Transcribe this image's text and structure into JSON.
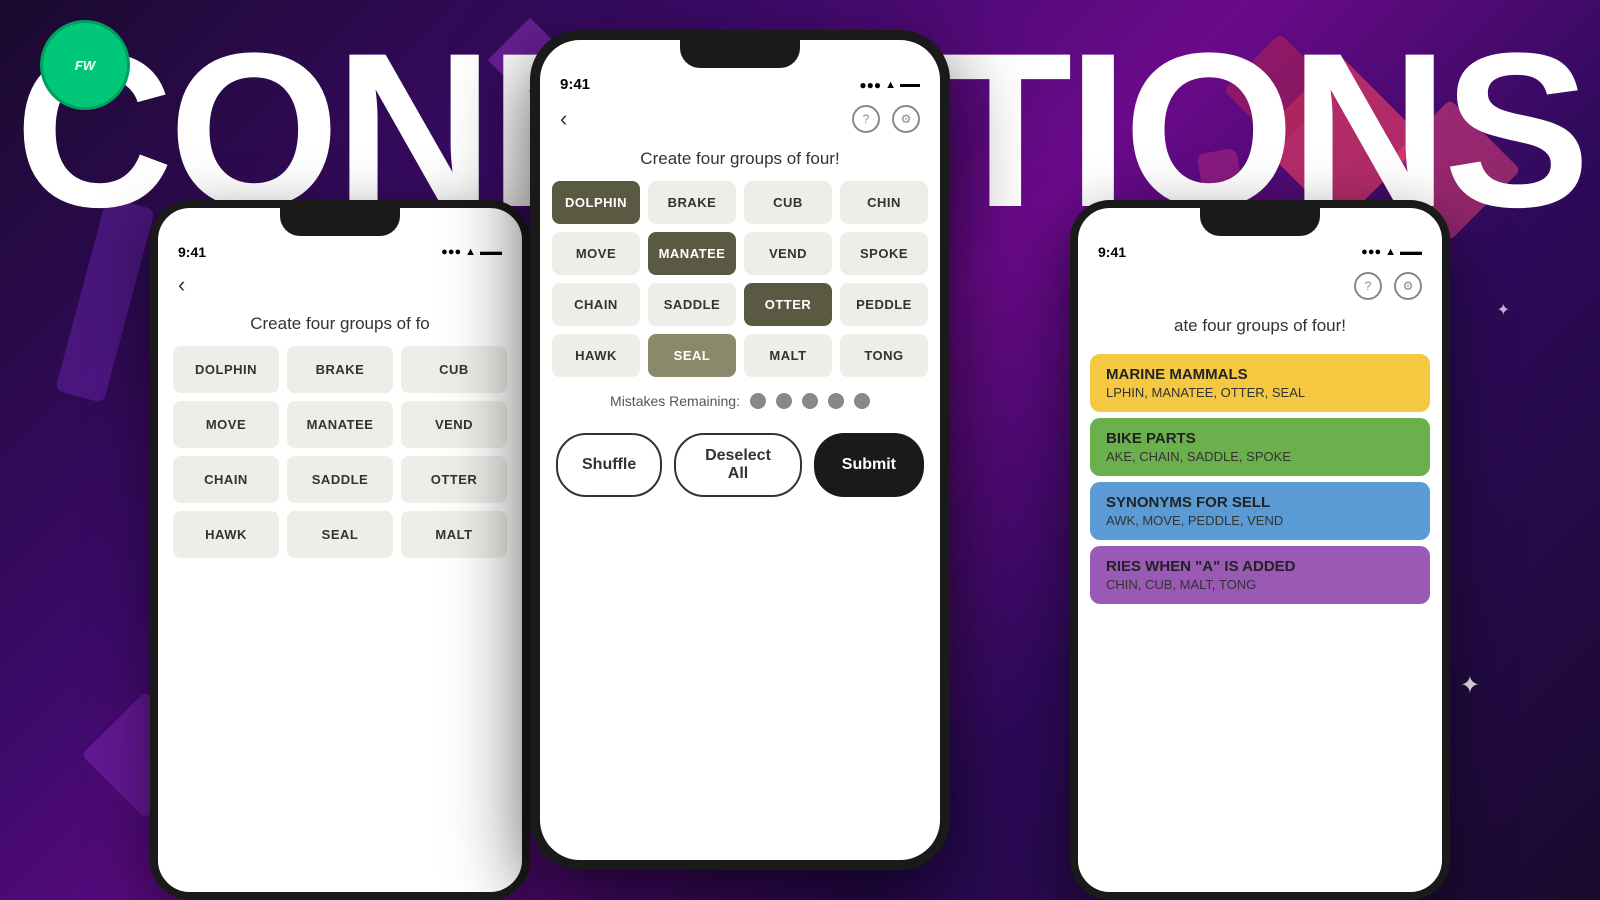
{
  "app": {
    "title": "Connections",
    "logo": "FW"
  },
  "background": {
    "title_text": "Connections"
  },
  "center_phone": {
    "status_time": "9:41",
    "header_back": "‹",
    "header_help": "?",
    "header_settings": "⚙",
    "game_title": "Create four groups of four!",
    "grid": [
      {
        "word": "DOLPHIN",
        "state": "selected-dark"
      },
      {
        "word": "BRAKE",
        "state": "normal"
      },
      {
        "word": "CUB",
        "state": "normal"
      },
      {
        "word": "CHIN",
        "state": "normal"
      },
      {
        "word": "MOVE",
        "state": "normal"
      },
      {
        "word": "MANATEE",
        "state": "selected-dark"
      },
      {
        "word": "VEND",
        "state": "normal"
      },
      {
        "word": "SPOKE",
        "state": "normal"
      },
      {
        "word": "CHAIN",
        "state": "normal"
      },
      {
        "word": "SADDLE",
        "state": "normal"
      },
      {
        "word": "OTTER",
        "state": "selected-dark"
      },
      {
        "word": "PEDDLE",
        "state": "normal"
      },
      {
        "word": "HAWK",
        "state": "normal"
      },
      {
        "word": "SEAL",
        "state": "selected-medium"
      },
      {
        "word": "MALT",
        "state": "normal"
      },
      {
        "word": "TONG",
        "state": "normal"
      }
    ],
    "mistakes_label": "Mistakes Remaining:",
    "dots": 5,
    "btn_shuffle": "Shuffle",
    "btn_deselect": "Deselect All",
    "btn_submit": "Submit"
  },
  "left_phone": {
    "status_time": "9:41",
    "header_back": "‹",
    "game_title": "Create four groups of fo",
    "grid": [
      "DOLPHIN",
      "BRAKE",
      "CUB",
      "MOVE",
      "MANATEE",
      "VEND",
      "CHAIN",
      "SADDLE",
      "OTTER",
      "HAWK",
      "SEAL",
      "MALT"
    ]
  },
  "right_phone": {
    "status_time": "9:41",
    "header_help": "?",
    "header_settings": "⚙",
    "game_title": "ate four groups of four!",
    "categories": [
      {
        "color": "yellow",
        "name": "MARINE MAMMALS",
        "words": "LPHIN, MANATEE, OTTER, SEAL"
      },
      {
        "color": "green",
        "name": "BIKE PARTS",
        "words": "AKE, CHAIN, SADDLE, SPOKE"
      },
      {
        "color": "blue",
        "name": "SYNONYMS FOR SELL",
        "words": "AWK, MOVE, PEDDLE, VEND"
      },
      {
        "color": "purple",
        "name": "RIES WHEN \"A\" IS ADDED",
        "words": "CHIN, CUB, MALT, TONG"
      }
    ]
  }
}
